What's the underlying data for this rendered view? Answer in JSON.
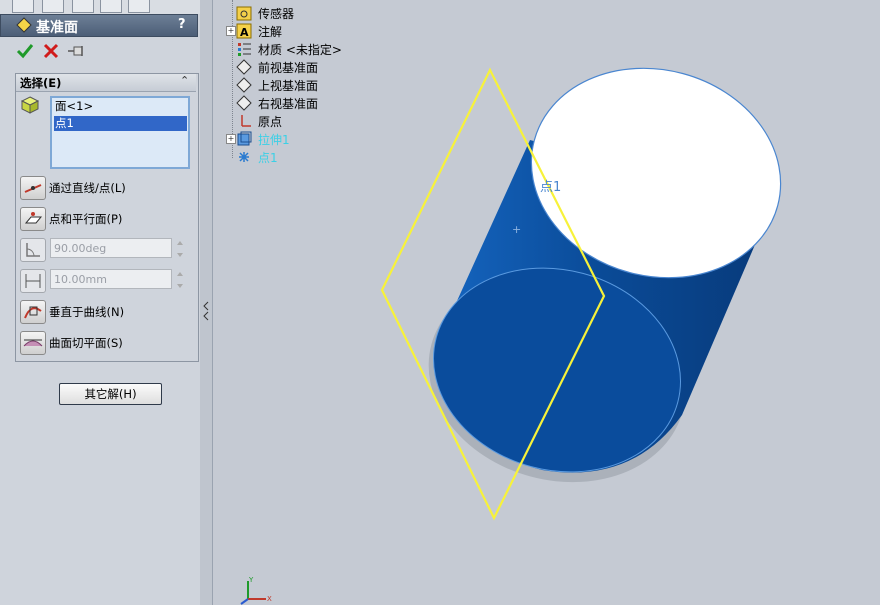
{
  "panel": {
    "title": "基准面",
    "help": "?",
    "colors": {
      "title_bg": "#4c5e77",
      "accent_select": "#3167c8",
      "plane": "#ffff33",
      "body": "#0a4a96"
    }
  },
  "selection": {
    "title": "选择(E)",
    "items": [
      "面<1>",
      "点1"
    ],
    "selected_index": 1
  },
  "options": {
    "through_line": "通过直线/点(L)",
    "parallel_plane": "点和平行面(P)",
    "angle_value": "90.00deg",
    "offset_value": "10.00mm",
    "normal_curve": "垂直于曲线(N)",
    "surface_tangent": "曲面切平面(S)"
  },
  "buttons": {
    "other_solutions": "其它解(H)"
  },
  "tree": {
    "items": [
      {
        "label": "传感器",
        "icon": "sensor-icon",
        "expander": false
      },
      {
        "label": "注解",
        "icon": "annotation-icon",
        "expander": true
      },
      {
        "label": "材质 <未指定>",
        "icon": "material-icon",
        "expander": false
      },
      {
        "label": "前视基准面",
        "icon": "plane-icon",
        "expander": false
      },
      {
        "label": "上视基准面",
        "icon": "plane-icon",
        "expander": false
      },
      {
        "label": "右视基准面",
        "icon": "plane-icon",
        "expander": false
      },
      {
        "label": "原点",
        "icon": "origin-icon",
        "expander": false
      },
      {
        "label": "拉伸1",
        "icon": "extrude-icon",
        "expander": true
      },
      {
        "label": "点1",
        "icon": "point-icon",
        "expander": false
      }
    ]
  },
  "viewport": {
    "point_label": "点1",
    "triad_x": "X",
    "triad_y": "Y"
  }
}
